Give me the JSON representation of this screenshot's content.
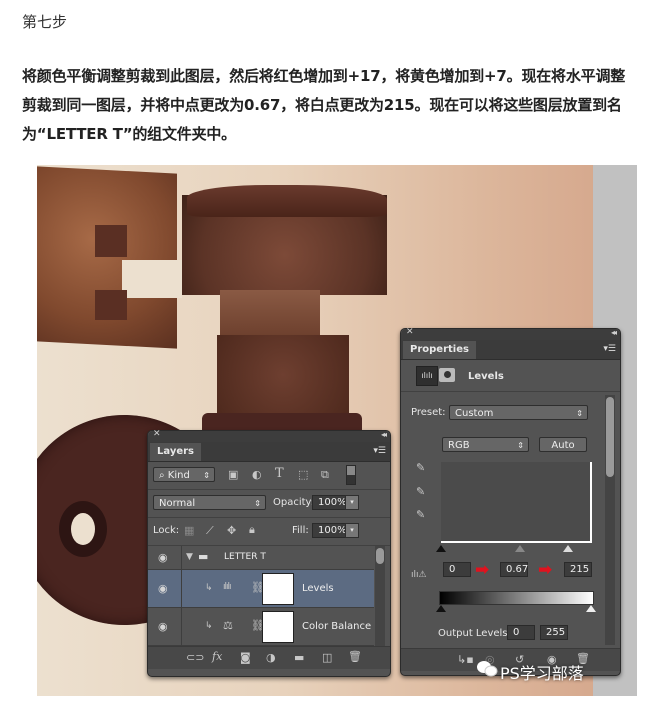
{
  "article": {
    "step_title": "第七步",
    "paragraph": "将颜色平衡调整剪裁到此图层，然后将红色增加到+17，将黄色增加到+7。现在将水平调整剪裁到同一图层，并将中点更改为0.67，将白点更改为215。现在可以将这些图层放置到名为“LETTER T”的组文件夹中。"
  },
  "layers_panel": {
    "tab": "Layers",
    "filter_kind": "Kind",
    "blend_mode": "Normal",
    "opacity_label": "Opacity:",
    "opacity_value": "100%",
    "lock_label": "Lock:",
    "fill_label": "Fill:",
    "fill_value": "100%",
    "layers": [
      {
        "name": "LETTER T",
        "type": "group",
        "expanded": true,
        "visible": true
      },
      {
        "name": "Levels",
        "type": "adjustment-levels",
        "clipped": true,
        "visible": true,
        "selected": true
      },
      {
        "name": "Color Balance",
        "type": "adjustment-color-balance",
        "clipped": true,
        "visible": true,
        "selected": false
      }
    ],
    "footer_icons": [
      "link-icon",
      "fx-icon",
      "mask-icon",
      "adjustment-icon",
      "folder-icon",
      "new-layer-icon",
      "trash-icon"
    ]
  },
  "properties_panel": {
    "tab": "Properties",
    "adjustment_title": "Levels",
    "preset_label": "Preset:",
    "preset_value": "Custom",
    "channel_value": "RGB",
    "auto_label": "Auto",
    "input_black": "0",
    "input_mid": "0.67",
    "input_white": "215",
    "output_label": "Output Levels:",
    "output_black": "0",
    "output_white": "255",
    "footer_icons": [
      "clip-icon",
      "view-previous-icon",
      "reset-icon",
      "visibility-icon",
      "trash-icon"
    ]
  },
  "highlight_color": "#e0121e",
  "watermark": "PS学习部落"
}
